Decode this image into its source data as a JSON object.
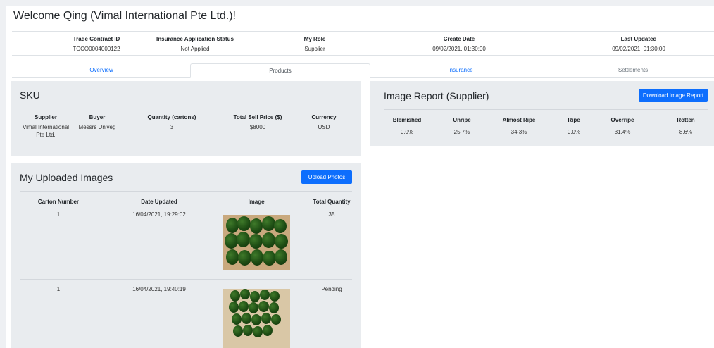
{
  "welcome": "Welcome Qing (Vimal International Pte Ltd.)!",
  "info": [
    {
      "header": "Trade Contract ID",
      "value": "TCCO0004000122"
    },
    {
      "header": "Insurance Application Status",
      "value": "Not Applied"
    },
    {
      "header": "My Role",
      "value": "Supplier"
    },
    {
      "header": "Create Date",
      "value": "09/02/2021, 01:30:00"
    },
    {
      "header": "Last Updated",
      "value": "09/02/2021, 01:30:00"
    }
  ],
  "tabs": [
    "Overview",
    "Products",
    "Insurance",
    "Settlements"
  ],
  "sku": {
    "title": "SKU",
    "headers": [
      "Supplier",
      "Buyer",
      "Quantity (cartons)",
      "Total Sell Price ($)",
      "Currency"
    ],
    "row": [
      "Vimal International Pte Ltd.",
      "Messrs Univeg",
      "3",
      "$8000",
      "USD"
    ]
  },
  "image_report": {
    "title": "Image Report (Supplier)",
    "button": "Download Image Report",
    "headers": [
      "Blemished",
      "Unripe",
      "Almost Ripe",
      "Ripe",
      "Overripe",
      "Rotten"
    ],
    "values": [
      "0.0%",
      "25.7%",
      "34.3%",
      "0.0%",
      "31.4%",
      "8.6%"
    ]
  },
  "uploads": {
    "title": "My Uploaded Images",
    "button": "Upload Photos",
    "headers": [
      "Carton Number",
      "Date Updated",
      "Image",
      "Total Quantity"
    ],
    "rows": [
      {
        "carton": "1",
        "date": "16/04/2021, 19:29:02",
        "quantity": "35"
      },
      {
        "carton": "1",
        "date": "16/04/2021, 19:40:19",
        "quantity": "Pending"
      }
    ]
  },
  "colors": {
    "primary": "#0d6efd",
    "panel": "#e9ecef"
  }
}
